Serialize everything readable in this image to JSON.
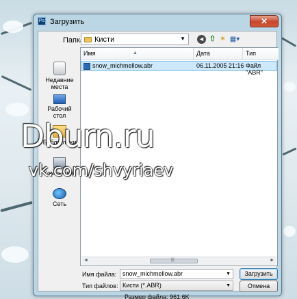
{
  "window": {
    "title": "Загрузить",
    "app_icon": "Ps",
    "close_label": "✕"
  },
  "folder_bar": {
    "label": "Папка:",
    "current_folder": "Кисти",
    "icons": [
      "back-icon",
      "up-folder-icon",
      "new-folder-icon",
      "view-menu-icon"
    ]
  },
  "places": [
    {
      "label": "Недавние места",
      "icon": "recent-places-icon"
    },
    {
      "label": "Рабочий стол",
      "icon": "desktop-icon"
    },
    {
      "label": "Библиотеки",
      "icon": "libraries-icon"
    },
    {
      "label": "Компьютер",
      "icon": "computer-icon"
    },
    {
      "label": "Сеть",
      "icon": "network-icon"
    }
  ],
  "file_list": {
    "columns": [
      "Имя",
      "Дата изменения",
      "Тип"
    ],
    "sort_column": "Имя",
    "rows": [
      {
        "name": "snow_michmellow.abr",
        "date": "06.11.2005 21:16",
        "type": "Файл \"ABR\"",
        "selected": true
      }
    ]
  },
  "bottom": {
    "filename_label": "Имя файла:",
    "filename_value": "snow_michmellow.abr",
    "filetype_label": "Тип файлов:",
    "filetype_value": "Кисти (*.ABR)",
    "open_button": "Загрузить",
    "cancel_button": "Отмена",
    "file_size": "Размер файла: 961,6K"
  },
  "watermark": {
    "line1": "Dburn.ru",
    "line2": "vk.com/shvyriaev"
  },
  "colors": {
    "selection_bg": "#cde8fb",
    "selection_border": "#84c1ea",
    "close_button": "#c7462b"
  }
}
